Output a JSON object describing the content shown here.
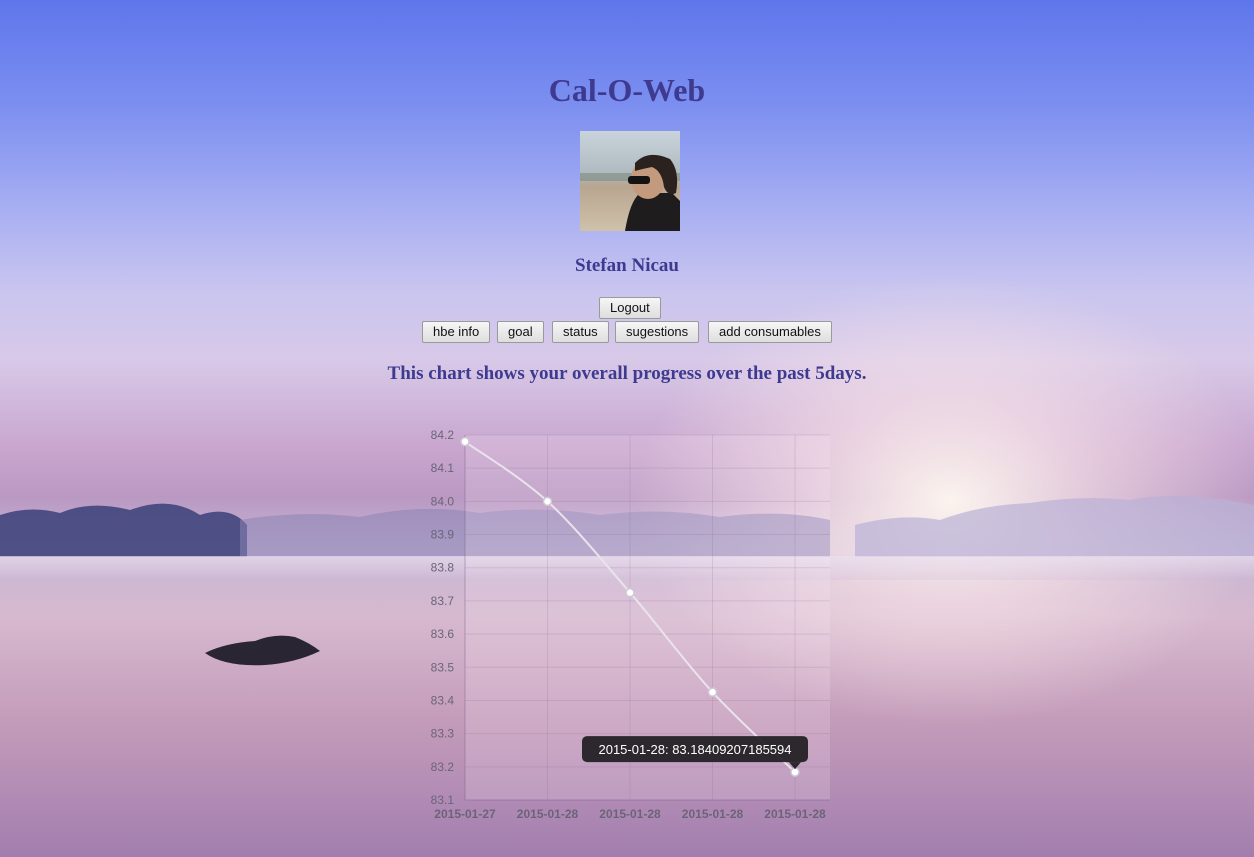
{
  "app": {
    "title": "Cal-O-Web"
  },
  "user": {
    "name": "Stefan Nicau"
  },
  "buttons": {
    "logout": "Logout",
    "hbe_info": "hbe info",
    "goal": "goal",
    "status": "status",
    "sugestions": "sugestions",
    "add_consumables": "add consumables"
  },
  "chart_description": "This chart shows your overall progress over the past 5days.",
  "chart_data": {
    "type": "line",
    "categories": [
      "2015-01-27",
      "2015-01-28",
      "2015-01-28",
      "2015-01-28",
      "2015-01-28"
    ],
    "values": [
      84.18,
      84.0,
      83.725,
      83.425,
      83.18409207185594
    ],
    "y_ticks": [
      "84.2",
      "84.1",
      "84.0",
      "83.9",
      "83.8",
      "83.7",
      "83.6",
      "83.5",
      "83.4",
      "83.3",
      "83.2",
      "83.1"
    ],
    "ylim": [
      83.1,
      84.2
    ],
    "grid": true,
    "line_color": "#e8e4ec",
    "tooltip": {
      "point_index": 4,
      "text": "2015-01-28: 83.18409207185594"
    }
  },
  "colors": {
    "title": "#3d3a8f",
    "tooltip_bg": "#1f1d22"
  }
}
